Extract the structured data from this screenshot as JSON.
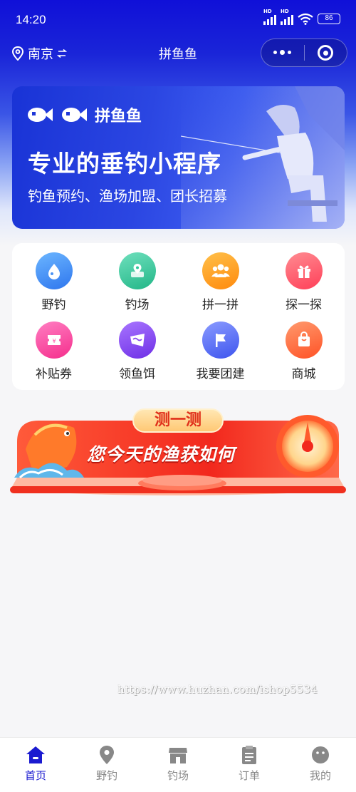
{
  "status_bar": {
    "time": "14:20",
    "battery": "86",
    "signal_badge_1": "HD",
    "signal_badge_2": "HD"
  },
  "nav": {
    "city": "南京",
    "title": "拼鱼鱼"
  },
  "hero": {
    "brand": "拼鱼鱼",
    "headline": "专业的垂钓小程序",
    "subline": "钓鱼预约、渔场加盟、团长招募"
  },
  "menu": {
    "items": [
      {
        "label": "野钓",
        "icon": "water-drop-icon",
        "color": "#3b8df5"
      },
      {
        "label": "钓场",
        "icon": "map-pin-icon",
        "color": "#2fc79a"
      },
      {
        "label": "拼一拼",
        "icon": "group-icon",
        "color": "#ffa21c"
      },
      {
        "label": "探一探",
        "icon": "gift-icon",
        "color": "#ff5d6a"
      },
      {
        "label": "补贴券",
        "icon": "ticket-icon",
        "color": "#ff4ea3"
      },
      {
        "label": "领鱼饵",
        "icon": "bait-icon",
        "color": "#8b4cf0"
      },
      {
        "label": "我要团建",
        "icon": "flag-icon",
        "color": "#5468f4"
      },
      {
        "label": "商城",
        "icon": "shopping-bag-icon",
        "color": "#ff6b3d"
      }
    ]
  },
  "promo": {
    "pill": "测一测",
    "text": "您今天的渔获如何"
  },
  "watermark": "https://www.huzhan.com/ishop5534",
  "tabbar": {
    "tabs": [
      {
        "label": "首页",
        "icon": "home-icon",
        "active": true
      },
      {
        "label": "野钓",
        "icon": "location-icon",
        "active": false
      },
      {
        "label": "钓场",
        "icon": "store-icon",
        "active": false
      },
      {
        "label": "订单",
        "icon": "clipboard-icon",
        "active": false
      },
      {
        "label": "我的",
        "icon": "profile-icon",
        "active": false
      }
    ]
  },
  "colors": {
    "primary": "#1a1ad0",
    "inactive": "#888888"
  }
}
